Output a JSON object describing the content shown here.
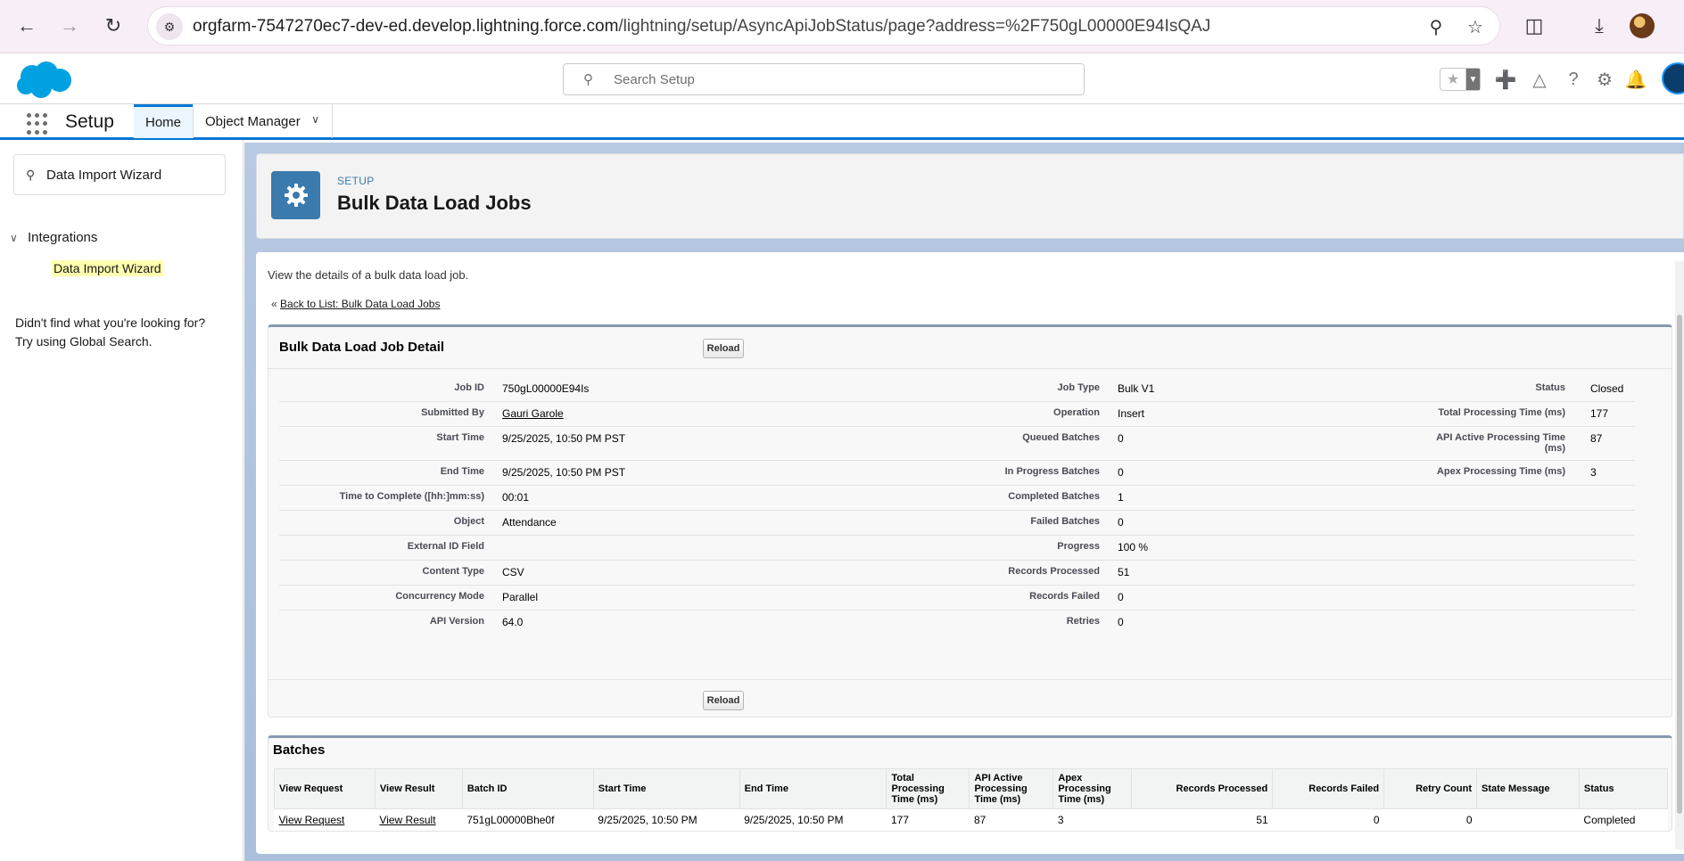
{
  "browser": {
    "url_host": "orgfarm-7547270ec7-dev-ed.develop.lightning.force.com",
    "url_path": "/lightning/setup/AsyncApiJobStatus/page?address=%2F750gL00000E94IsQAJ"
  },
  "header": {
    "search_placeholder": "Search Setup"
  },
  "nav": {
    "app_name": "Setup",
    "tabs": [
      {
        "label": "Home"
      },
      {
        "label": "Object Manager"
      }
    ]
  },
  "sidebar": {
    "quick_find_value": "Data Import Wizard",
    "group_label": "Integrations",
    "item_label": "Data Import Wizard",
    "not_found_line1": "Didn't find what you're looking for?",
    "not_found_line2": "Try using Global Search."
  },
  "page_header": {
    "eyebrow": "SETUP",
    "title": "Bulk Data Load Jobs"
  },
  "content": {
    "description": "View the details of a bulk data load job.",
    "back_prefix": "«",
    "back_link": "Back to List: Bulk Data Load Jobs"
  },
  "detail": {
    "title": "Bulk Data Load Job Detail",
    "reload_label": "Reload",
    "rows": [
      {
        "l1": "Job ID",
        "v1": "750gL00000E94Is",
        "l2": "Job Type",
        "v2": "Bulk V1",
        "l3": "Status",
        "v3": "Closed"
      },
      {
        "l1": "Submitted By",
        "v1": "Gauri Garole",
        "l2": "Operation",
        "v2": "Insert",
        "l3": "Total Processing Time (ms)",
        "v3": "177"
      },
      {
        "l1": "Start Time",
        "v1": "9/25/2025, 10:50 PM PST",
        "l2": "Queued Batches",
        "v2": "0",
        "l3": "API Active Processing Time (ms)",
        "v3": "87"
      },
      {
        "l1": "End Time",
        "v1": "9/25/2025, 10:50 PM PST",
        "l2": "In Progress Batches",
        "v2": "0",
        "l3": "Apex Processing Time (ms)",
        "v3": "3"
      },
      {
        "l1": "Time to Complete ([hh:]mm:ss)",
        "v1": "00:01",
        "l2": "Completed Batches",
        "v2": "1",
        "l3": "",
        "v3": ""
      },
      {
        "l1": "Object",
        "v1": "Attendance",
        "l2": "Failed Batches",
        "v2": "0",
        "l3": "",
        "v3": ""
      },
      {
        "l1": "External ID Field",
        "v1": "",
        "l2": "Progress",
        "v2": "100 %",
        "l3": "",
        "v3": ""
      },
      {
        "l1": "Content Type",
        "v1": "CSV",
        "l2": "Records Processed",
        "v2": "51",
        "l3": "",
        "v3": ""
      },
      {
        "l1": "Concurrency Mode",
        "v1": "Parallel",
        "l2": "Records Failed",
        "v2": "0",
        "l3": "",
        "v3": ""
      },
      {
        "l1": "API Version",
        "v1": "64.0",
        "l2": "Retries",
        "v2": "0",
        "l3": "",
        "v3": ""
      }
    ]
  },
  "batches": {
    "title": "Batches",
    "columns": [
      "View Request",
      "View Result",
      "Batch ID",
      "Start Time",
      "End Time",
      "Total Processing Time (ms)",
      "API Active Processing Time (ms)",
      "Apex Processing Time (ms)",
      "Records Processed",
      "Records Failed",
      "Retry Count",
      "State Message",
      "Status"
    ],
    "rows": [
      [
        "View Request",
        "View Result",
        "751gL00000Bhe0f",
        "9/25/2025, 10:50 PM",
        "9/25/2025, 10:50 PM",
        "177",
        "87",
        "3",
        "51",
        "0",
        "0",
        "",
        "Completed"
      ]
    ]
  },
  "colors": {
    "brand_blue": "#0176d3",
    "setup_icon_bg": "#3b7aac",
    "section_border": "#8598b0"
  }
}
